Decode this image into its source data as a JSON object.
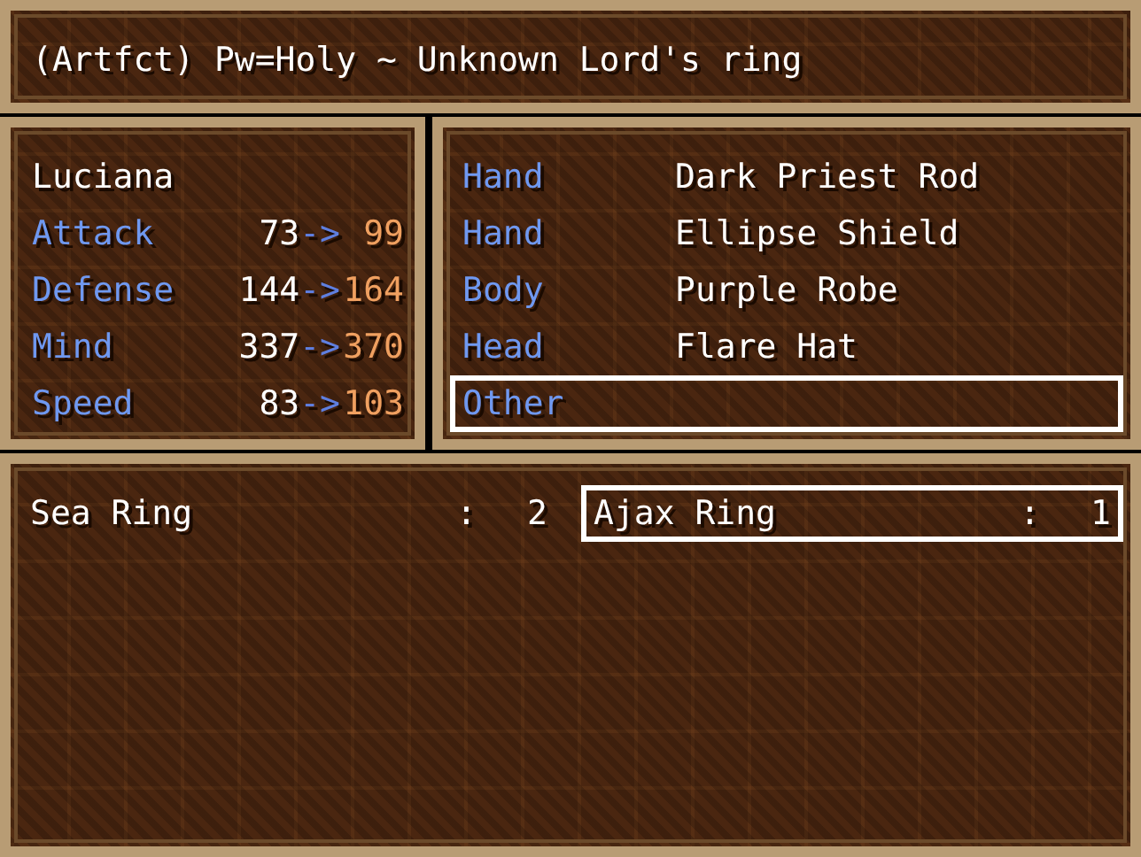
{
  "help_text": "(Artfct) Pw=Holy ~ Unknown Lord's ring",
  "character": {
    "name": "Luciana",
    "stats": [
      {
        "label": "Attack",
        "current": "73",
        "arrow": "->",
        "new": " 99"
      },
      {
        "label": "Defense",
        "current": "144",
        "arrow": "->",
        "new": "164"
      },
      {
        "label": "Mind",
        "current": "337",
        "arrow": "->",
        "new": "370"
      },
      {
        "label": "Speed",
        "current": "83",
        "arrow": "->",
        "new": "103"
      }
    ]
  },
  "equipment": [
    {
      "slot": "Hand",
      "item": "Dark Priest Rod",
      "selected": false
    },
    {
      "slot": "Hand",
      "item": "Ellipse Shield",
      "selected": false
    },
    {
      "slot": "Body",
      "item": "Purple Robe",
      "selected": false
    },
    {
      "slot": "Head",
      "item": "Flare Hat",
      "selected": false
    },
    {
      "slot": "Other",
      "selected": true
    }
  ],
  "items": [
    {
      "name": "Sea Ring",
      "separator": ":",
      "count": "2",
      "selected": false
    },
    {
      "name": "Ajax Ring",
      "separator": ":",
      "count": "1",
      "selected": true
    }
  ]
}
